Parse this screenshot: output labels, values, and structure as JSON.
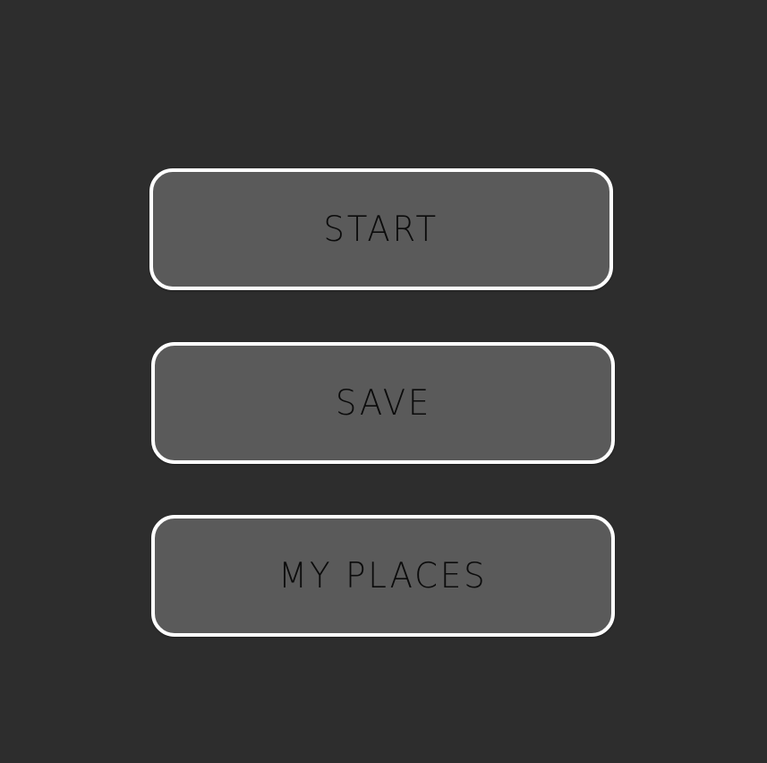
{
  "menu": {
    "buttons": [
      {
        "label": "START"
      },
      {
        "label": "SAVE"
      },
      {
        "label": "MY PLACES"
      }
    ]
  },
  "colors": {
    "background": "#2d2d2d",
    "button_fill": "#5a5a5a",
    "button_border": "#ffffff",
    "button_text": "#0b0b0b"
  }
}
